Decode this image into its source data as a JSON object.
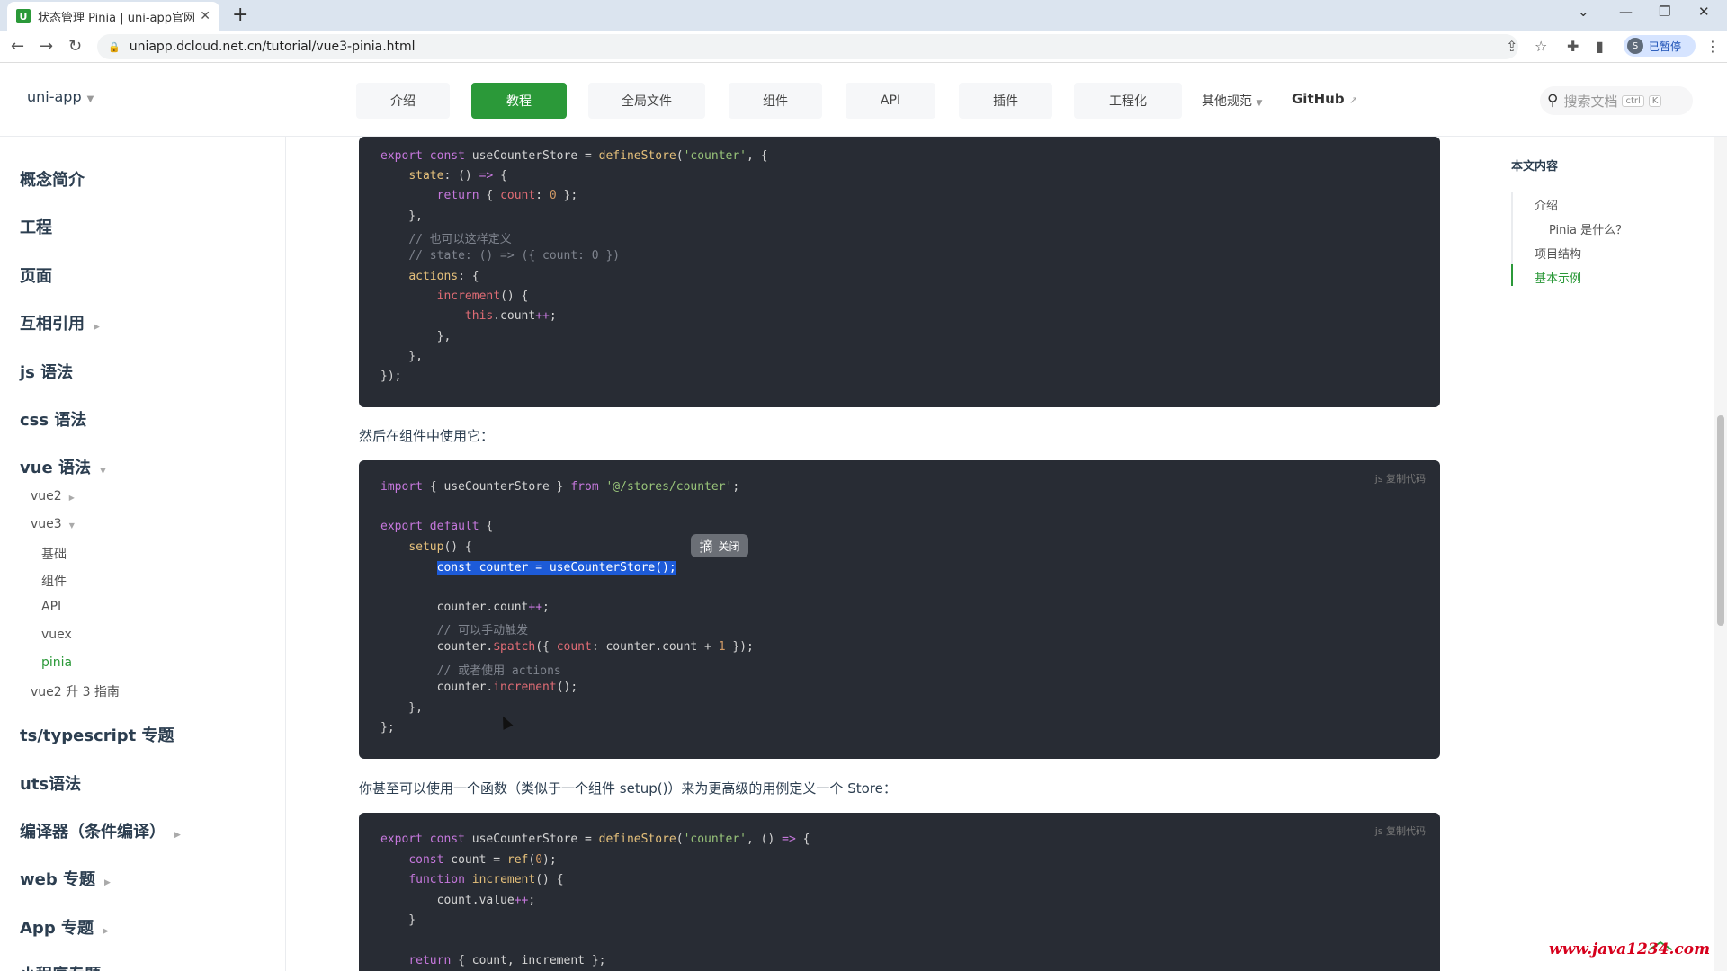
{
  "browser": {
    "tab_title": "状态管理 Pinia | uni-app官网",
    "tab_icon_letter": "U",
    "url": "uniapp.dcloud.net.cn/tutorial/vue3-pinia.html",
    "profile_label": "已暂停",
    "profile_initial": "S"
  },
  "header": {
    "brand": "uni-app",
    "nav": [
      "介绍",
      "教程",
      "全局文件",
      "组件",
      "API",
      "插件",
      "工程化",
      "其他规范",
      "GitHub"
    ],
    "active_nav": "教程",
    "search_placeholder": "搜索文档",
    "kbd1": "ctrl",
    "kbd2": "K"
  },
  "sidebar": {
    "items": [
      "概念简介",
      "工程",
      "页面",
      "互相引用",
      "js 语法",
      "css 语法",
      "vue 语法",
      "ts/typescript 专题",
      "uts语法",
      "编译器（条件编译）",
      "web 专题",
      "App 专题",
      "小程序专题"
    ],
    "sub": [
      "vue2",
      "vue3",
      "基础",
      "组件",
      "API",
      "vuex",
      "pinia",
      "vue2 升 3 指南"
    ],
    "active": "pinia"
  },
  "content": {
    "text1": "然后在组件中使用它：",
    "text2": "你甚至可以使用一个函数（类似于一个组件 setup()）来为更高级的用例定义一个 Store：",
    "lang_label": "js  复制代码",
    "tooltip_big": "摘",
    "tooltip_small": "关闭"
  },
  "toc": {
    "title": "本文内容",
    "items": [
      "介绍",
      "Pinia 是什么？",
      "项目结构",
      "基本示例"
    ],
    "active": "基本示例"
  },
  "watermark": "www.java1234.com",
  "colors": {
    "accent": "#2b9939",
    "code_bg": "#282c34",
    "selection": "#1d5bd8"
  }
}
